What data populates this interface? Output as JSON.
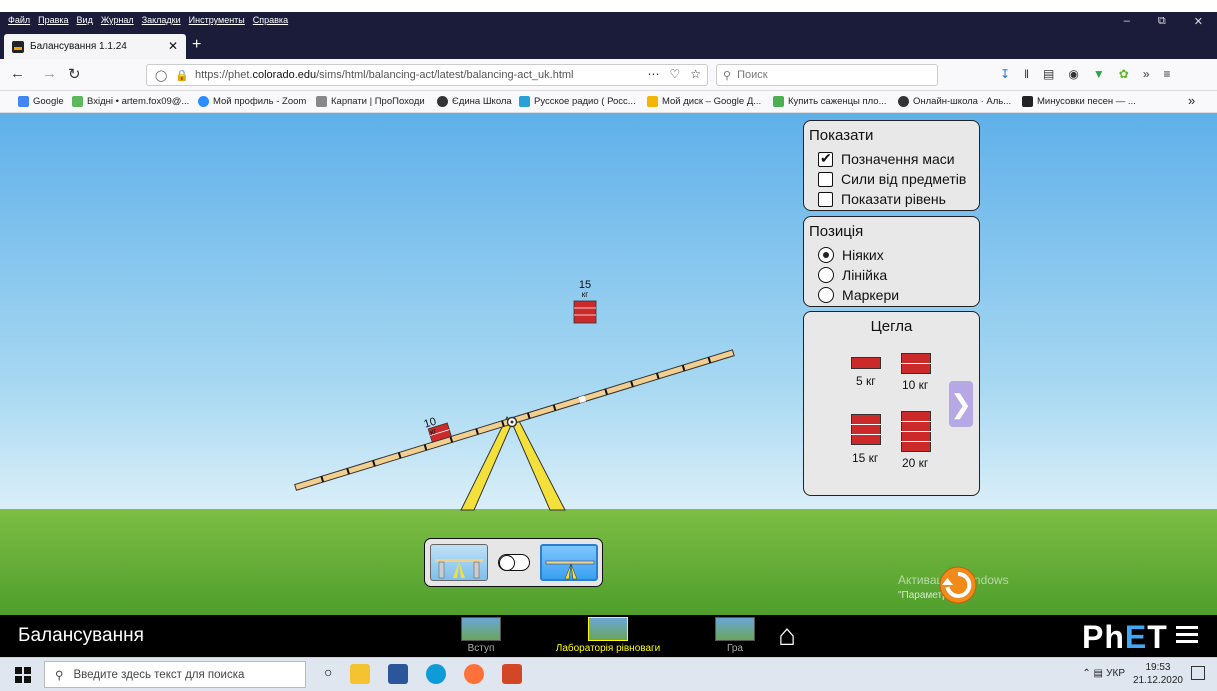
{
  "browser": {
    "menu": [
      "Файл",
      "Правка",
      "Вид",
      "Журнал",
      "Закладки",
      "Инструменты",
      "Справка"
    ],
    "window_controls": [
      "–",
      "⧉",
      "✕"
    ],
    "tab": {
      "title": "Балансування 1.1.24",
      "close": "✕",
      "new": "+"
    },
    "url": {
      "prefix": "https://phet.",
      "host": "colorado.edu",
      "path": "/sims/html/balancing-act/latest/balancing-act_uk.html"
    },
    "search_placeholder": "Поиск",
    "bookmarks": [
      "Google",
      "Вхідні • artem.fox09@...",
      "Мой профиль - Zoom",
      "Карпати | ПроПоходи",
      "Єдина Школа",
      "Русское радио ( Росс...",
      "Мой диск – Google Д...",
      "Купить саженцы пло...",
      "Онлайн-школа · Аль...",
      "Минусовки песен — ..."
    ],
    "bookmarks_more": "»"
  },
  "sim": {
    "show_panel": {
      "title": "Показати",
      "items": [
        {
          "label": "Позначення маси",
          "checked": true
        },
        {
          "label": "Сили від предметів",
          "checked": false
        },
        {
          "label": "Показати рівень",
          "checked": false
        }
      ]
    },
    "position_panel": {
      "title": "Позиція",
      "items": [
        {
          "label": "Ніяких",
          "selected": true
        },
        {
          "label": "Лінійка",
          "selected": false
        },
        {
          "label": "Маркери",
          "selected": false
        }
      ]
    },
    "bricks_panel": {
      "title": "Цегла",
      "items": [
        "5 кг",
        "10 кг",
        "15 кг",
        "20 кг"
      ]
    },
    "plank_masses": [
      {
        "mass": "15",
        "unit": "кг"
      },
      {
        "mass": "10",
        "unit": "кг"
      }
    ],
    "watermark": "Активация Windows",
    "watermark_sub": "\"Параметры\"."
  },
  "navbar": {
    "title": "Балансування",
    "screens": [
      "Вступ",
      "Лабораторія рівноваги",
      "Гра"
    ],
    "active_screen": "Лабораторія рівноваги",
    "brand": "PhET"
  },
  "taskbar": {
    "search": "Введите здесь текст для поиска",
    "lang": "УКР",
    "time": "19:53",
    "date": "21.12.2020"
  },
  "colors": {
    "brick": "#cc2a2a",
    "plank": "#f2cf8f",
    "fulcrum": "#f4e03a",
    "active_screen": "#ffff00"
  }
}
